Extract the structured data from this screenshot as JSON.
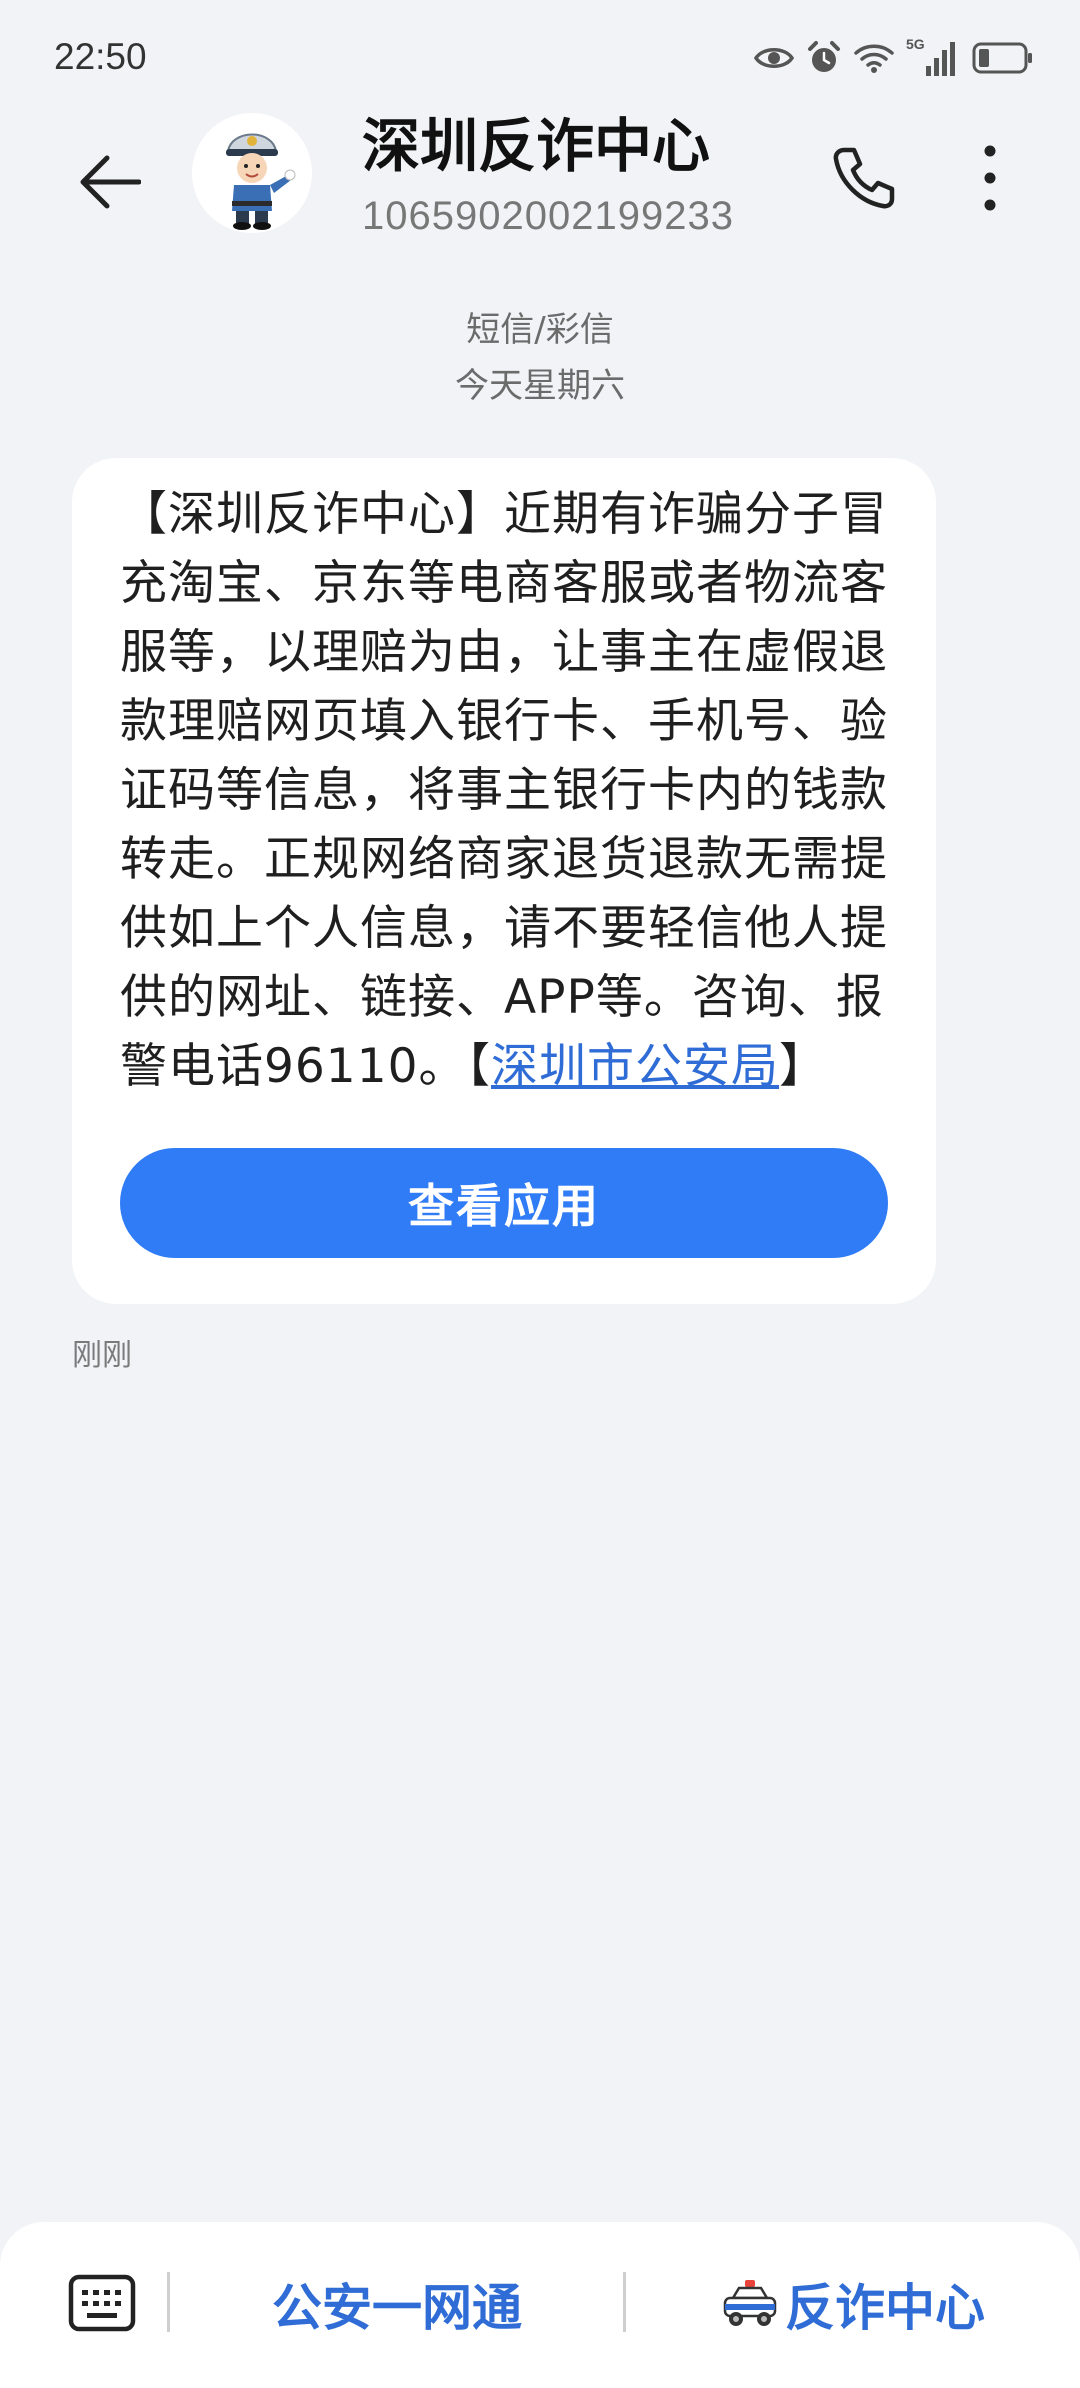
{
  "status_bar": {
    "time": "22:50",
    "network_label": "5G"
  },
  "header": {
    "contact_name": "深圳反诈中心",
    "contact_number": "1065902002199233"
  },
  "conversation": {
    "channel_label": "短信/彩信",
    "date_label": "今天星期六",
    "message": {
      "body": "【深圳反诈中心】近期有诈骗分子冒充淘宝、京东等电商客服或者物流客服等，以理赔为由，让事主在虚假退款理赔网页填入银行卡、手机号、验证码等信息，将事主银行卡内的钱款转走。正规网络商家退货退款无需提供如上个人信息，请不要轻信他人提供的网址、链接、APP等。咨询、报警电话96110。【",
      "link_text": "深圳市公安局",
      "suffix": "】",
      "button_label": "查看应用",
      "time": "刚刚"
    }
  },
  "bottom_menu": {
    "item1_label": "公安一网通",
    "item2_label": "反诈中心"
  },
  "colors": {
    "background": "#f1f3f6",
    "accent": "#2f7cf6",
    "link": "#2f6cd6",
    "bubble": "#ffffff"
  },
  "icons": {
    "back": "arrow-left-icon",
    "phone": "phone-icon",
    "more": "more-vertical-icon",
    "keyboard": "keyboard-icon",
    "police_car": "police-car-icon",
    "eye": "eye-icon",
    "alarm": "alarm-icon",
    "wifi": "wifi-icon",
    "signal": "signal-icon",
    "battery": "battery-icon"
  }
}
